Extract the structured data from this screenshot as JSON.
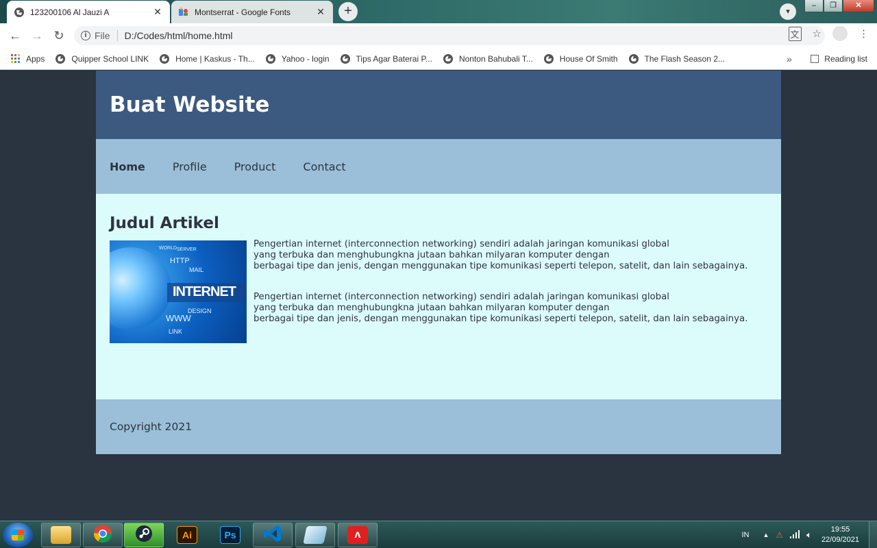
{
  "browser": {
    "tabs": [
      {
        "label": "123200106 Al Jauzi A",
        "active": true
      },
      {
        "label": "Montserrat - Google Fonts",
        "active": false
      }
    ],
    "address": {
      "scheme_label": "File",
      "url": "D:/Codes/html/home.html"
    },
    "bookmarks": [
      {
        "label": "Apps"
      },
      {
        "label": "Quipper School LINK"
      },
      {
        "label": "Home | Kaskus - Th..."
      },
      {
        "label": "Yahoo - login"
      },
      {
        "label": "Tips Agar Baterai P..."
      },
      {
        "label": "Nonton Bahubali T..."
      },
      {
        "label": "House Of Smith"
      },
      {
        "label": "The Flash Season 2..."
      }
    ],
    "bookmarks_more": "»",
    "reading_list": "Reading list"
  },
  "page": {
    "site_title": "Buat Website",
    "nav": [
      {
        "label": "Home",
        "active": true
      },
      {
        "label": "Profile",
        "active": false
      },
      {
        "label": "Product",
        "active": false
      },
      {
        "label": "Contact",
        "active": false
      }
    ],
    "article": {
      "heading": "Judul Artikel",
      "image_text": {
        "main": "INTERNET",
        "http": "HTTP",
        "www": "WWW",
        "mail": "MAIL",
        "design": "DESIGN",
        "link": "LINK",
        "world": "WORLD",
        "server": "SERVER"
      },
      "paragraphs": [
        {
          "line1": "Pengertian internet (interconnection networking) sendiri adalah jaringan komunikasi global",
          "line2": "yang terbuka dan menghubungkna jutaan bahkan milyaran komputer dengan",
          "line3": "berbagai tipe dan jenis, dengan menggunakan tipe komunikasi seperti telepon, satelit, dan lain sebagainya."
        },
        {
          "line1": "Pengertian internet (interconnection networking) sendiri adalah jaringan komunikasi global",
          "line2": "yang terbuka dan menghubungkna jutaan bahkan milyaran komputer dengan",
          "line3": "berbagai tipe dan jenis, dengan menggunakan tipe komunikasi seperti telepon, satelit, dan lain sebagainya."
        }
      ]
    },
    "footer": "Copyright 2021"
  },
  "taskbar": {
    "apps": [
      {
        "name": "file-explorer"
      },
      {
        "name": "chrome"
      },
      {
        "name": "steam"
      },
      {
        "name": "illustrator",
        "label": "Ai"
      },
      {
        "name": "photoshop",
        "label": "Ps"
      },
      {
        "name": "vscode"
      },
      {
        "name": "notes"
      },
      {
        "name": "acrobat"
      }
    ],
    "language": "IN",
    "time": "19:55",
    "date": "22/09/2021"
  },
  "colors": {
    "header": "#3c5a80",
    "nav": "#9bbfd8",
    "main": "#dcfbfb",
    "page_bg": "#2a3340"
  }
}
